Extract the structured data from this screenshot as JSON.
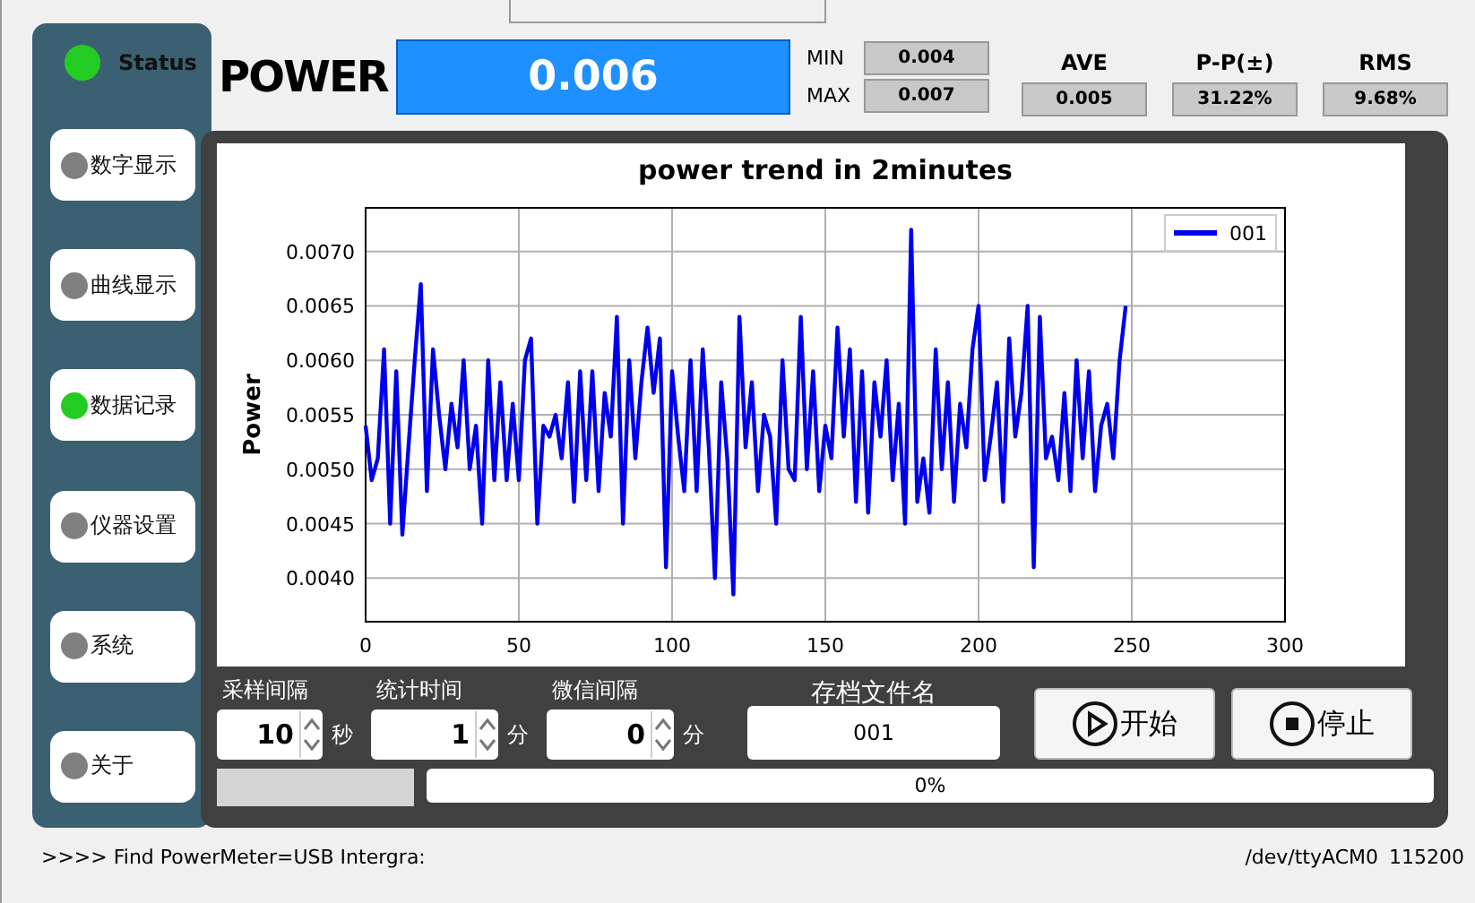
{
  "sidebar": {
    "status": {
      "label": "Status",
      "color": "#22cc22"
    },
    "items": [
      {
        "label": "数字显示",
        "color": "#808080"
      },
      {
        "label": "曲线显示",
        "color": "#808080"
      },
      {
        "label": "数据记录",
        "color": "#22cc22"
      },
      {
        "label": "仪器设置",
        "color": "#808080"
      },
      {
        "label": "系统",
        "color": "#808080"
      },
      {
        "label": "关于",
        "color": "#808080"
      }
    ]
  },
  "header": {
    "title": "POWER",
    "value": "0.006",
    "min_label": "MIN",
    "min": "0.004",
    "max_label": "MAX",
    "max": "0.007",
    "stats": [
      {
        "label": "AVE",
        "value": "0.005"
      },
      {
        "label": "P-P(±)",
        "value": "31.22%"
      },
      {
        "label": "RMS",
        "value": "9.68%"
      }
    ]
  },
  "chart": {
    "chart_data": {
      "type": "line",
      "grid": true,
      "title": "power trend in 2minutes",
      "ylabel": "Power",
      "xlim": [
        0,
        300
      ],
      "ylim": [
        0.0036,
        0.0074
      ],
      "xticks": [
        0,
        50,
        100,
        150,
        200,
        250,
        300
      ],
      "yticks": [
        {
          "value": 0.004,
          "label": "0.0040"
        },
        {
          "value": 0.0045,
          "label": "0.0045"
        },
        {
          "value": 0.005,
          "label": "0.0050"
        },
        {
          "value": 0.0055,
          "label": "0.0055"
        },
        {
          "value": 0.006,
          "label": "0.0060"
        },
        {
          "value": 0.0065,
          "label": "0.0065"
        },
        {
          "value": 0.007,
          "label": "0.0070"
        }
      ],
      "x": [
        0,
        2,
        4,
        6,
        8,
        10,
        12,
        14,
        16,
        18,
        20,
        22,
        24,
        26,
        28,
        30,
        32,
        34,
        36,
        38,
        40,
        42,
        44,
        46,
        48,
        50,
        52,
        54,
        56,
        58,
        60,
        62,
        64,
        66,
        68,
        70,
        72,
        74,
        76,
        78,
        80,
        82,
        84,
        86,
        88,
        90,
        92,
        94,
        96,
        98,
        100,
        102,
        104,
        106,
        108,
        110,
        112,
        114,
        116,
        118,
        120,
        122,
        124,
        126,
        128,
        130,
        132,
        134,
        136,
        138,
        140,
        142,
        144,
        146,
        148,
        150,
        152,
        154,
        156,
        158,
        160,
        162,
        164,
        166,
        168,
        170,
        172,
        174,
        176,
        178,
        180,
        182,
        184,
        186,
        188,
        190,
        192,
        194,
        196,
        198,
        200,
        202,
        204,
        206,
        208,
        210,
        212,
        214,
        216,
        218,
        220,
        222,
        224,
        226,
        228,
        230,
        232,
        234,
        236,
        238,
        240,
        242,
        244,
        246,
        248
      ],
      "series": [
        {
          "name": "001",
          "color": "#0000ee",
          "values": [
            0.0054,
            0.0049,
            0.0051,
            0.0061,
            0.0045,
            0.0059,
            0.0044,
            0.0052,
            0.006,
            0.0067,
            0.0048,
            0.0061,
            0.0055,
            0.005,
            0.0056,
            0.0052,
            0.006,
            0.005,
            0.0054,
            0.0045,
            0.006,
            0.0049,
            0.0058,
            0.0049,
            0.0056,
            0.0049,
            0.006,
            0.0062,
            0.0045,
            0.0054,
            0.0053,
            0.0055,
            0.0051,
            0.0058,
            0.0047,
            0.0059,
            0.0049,
            0.0059,
            0.0048,
            0.0057,
            0.0053,
            0.0064,
            0.0045,
            0.006,
            0.0051,
            0.0058,
            0.0063,
            0.0057,
            0.0062,
            0.0041,
            0.0059,
            0.0053,
            0.0048,
            0.006,
            0.0048,
            0.0061,
            0.0052,
            0.004,
            0.0058,
            0.0051,
            0.00385,
            0.0064,
            0.0052,
            0.0058,
            0.0048,
            0.0055,
            0.0053,
            0.0045,
            0.006,
            0.005,
            0.0049,
            0.0064,
            0.005,
            0.0059,
            0.0048,
            0.0054,
            0.0051,
            0.0063,
            0.0053,
            0.0061,
            0.0047,
            0.0059,
            0.0046,
            0.0058,
            0.0053,
            0.006,
            0.0049,
            0.0056,
            0.0045,
            0.0072,
            0.0047,
            0.0051,
            0.0046,
            0.0061,
            0.005,
            0.0058,
            0.0047,
            0.0056,
            0.0052,
            0.0061,
            0.0065,
            0.0049,
            0.0053,
            0.0058,
            0.0047,
            0.0062,
            0.0053,
            0.0057,
            0.0065,
            0.0041,
            0.0064,
            0.0051,
            0.0053,
            0.0049,
            0.0057,
            0.0048,
            0.006,
            0.0051,
            0.0059,
            0.0048,
            0.0054,
            0.0056,
            0.0051,
            0.006,
            0.0065
          ]
        }
      ]
    }
  },
  "controls": {
    "spinners": [
      {
        "label": "采样间隔",
        "value": "10",
        "unit": "秒"
      },
      {
        "label": "统计时间",
        "value": "1",
        "unit": "分"
      },
      {
        "label": "微信间隔",
        "value": "0",
        "unit": "分"
      }
    ],
    "file": {
      "label": "存档文件名",
      "value": "001"
    },
    "buttons": [
      {
        "kind": "play",
        "label": "开始"
      },
      {
        "kind": "stop",
        "label": "停止"
      }
    ],
    "progress": {
      "level": 0,
      "text": "0%"
    }
  },
  "status_bar": {
    "message": ">>>> Find PowerMeter=USB Intergra:",
    "port": "/dev/ttyACM0",
    "baud": "115200"
  }
}
